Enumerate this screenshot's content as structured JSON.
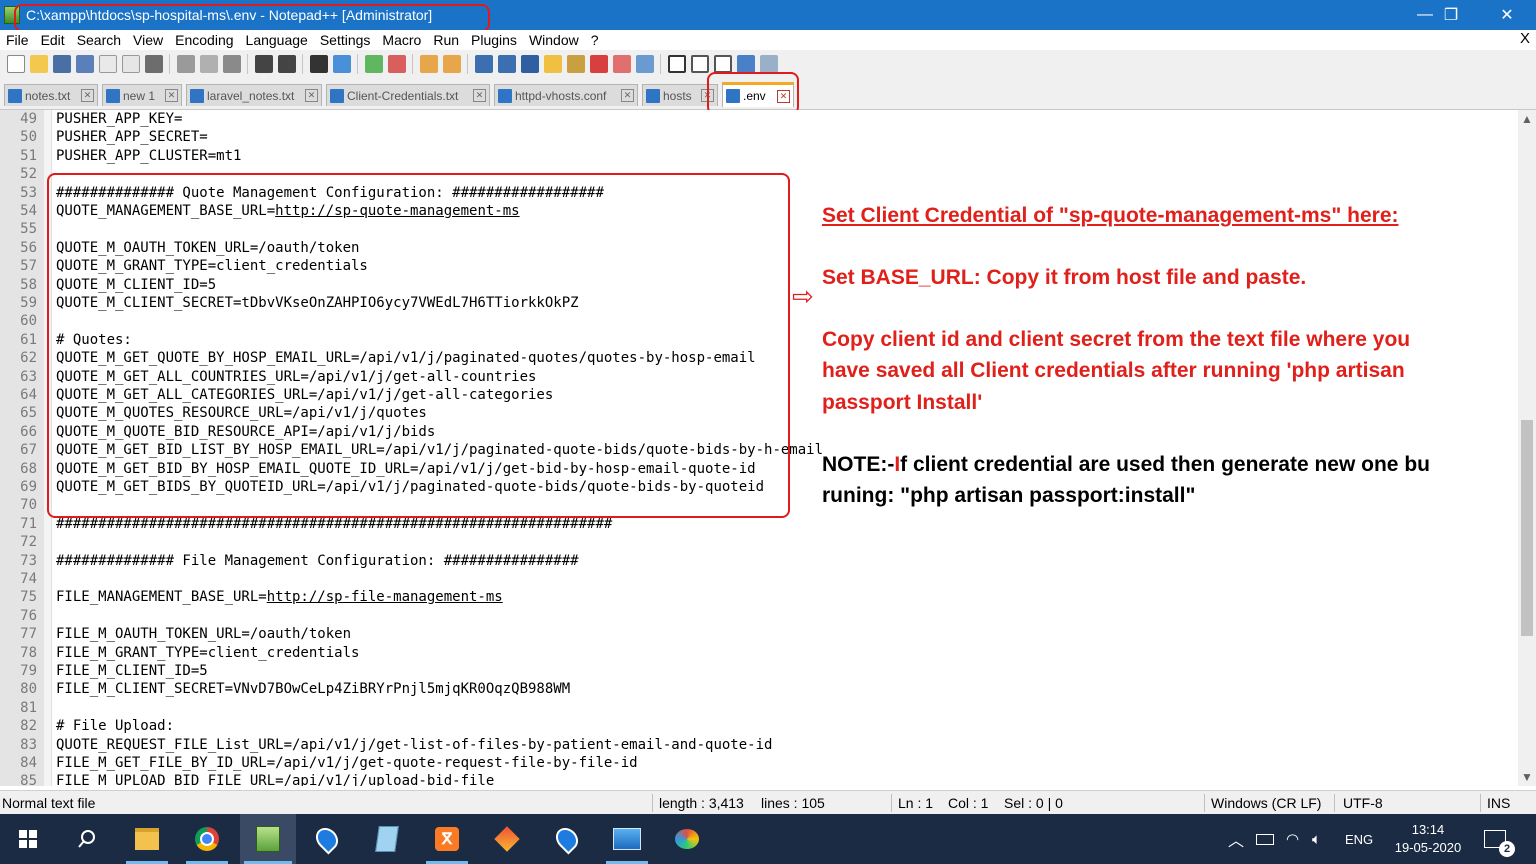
{
  "window": {
    "title": "C:\\xampp\\htdocs\\sp-hospital-ms\\.env - Notepad++ [Administrator]",
    "minimize": "—",
    "maximize": "❐",
    "close": "✕"
  },
  "menu": {
    "items": [
      "File",
      "Edit",
      "Search",
      "View",
      "Encoding",
      "Language",
      "Settings",
      "Macro",
      "Run",
      "Plugins",
      "Window",
      "?"
    ],
    "close_doc": "X"
  },
  "tabs": [
    {
      "label": "notes.txt",
      "active": false
    },
    {
      "label": "new 1",
      "active": false
    },
    {
      "label": "laravel_notes.txt",
      "active": false
    },
    {
      "label": "Client-Credentials.txt",
      "active": false
    },
    {
      "label": "httpd-vhosts.conf",
      "active": false
    },
    {
      "label": "hosts",
      "active": false
    },
    {
      "label": ".env",
      "active": true
    }
  ],
  "editor": {
    "lines": [
      {
        "n": "49",
        "text": "PUSHER_APP_KEY="
      },
      {
        "n": "50",
        "text": "PUSHER_APP_SECRET="
      },
      {
        "n": "51",
        "text": "PUSHER_APP_CLUSTER=mt1"
      },
      {
        "n": "52",
        "text": ""
      },
      {
        "n": "53",
        "text": "############## Quote Management Configuration: ##################"
      },
      {
        "n": "54",
        "text": "QUOTE_MANAGEMENT_BASE_URL=",
        "link": "http://sp-quote-management-ms"
      },
      {
        "n": "55",
        "text": ""
      },
      {
        "n": "56",
        "text": "QUOTE_M_OAUTH_TOKEN_URL=/oauth/token"
      },
      {
        "n": "57",
        "text": "QUOTE_M_GRANT_TYPE=client_credentials"
      },
      {
        "n": "58",
        "text": "QUOTE_M_CLIENT_ID=5"
      },
      {
        "n": "59",
        "text": "QUOTE_M_CLIENT_SECRET=tDbvVKseOnZAHPIO6ycy7VWEdL7H6TTiorkkOkPZ"
      },
      {
        "n": "60",
        "text": ""
      },
      {
        "n": "61",
        "text": "# Quotes:"
      },
      {
        "n": "62",
        "text": "QUOTE_M_GET_QUOTE_BY_HOSP_EMAIL_URL=/api/v1/j/paginated-quotes/quotes-by-hosp-email"
      },
      {
        "n": "63",
        "text": "QUOTE_M_GET_ALL_COUNTRIES_URL=/api/v1/j/get-all-countries"
      },
      {
        "n": "64",
        "text": "QUOTE_M_GET_ALL_CATEGORIES_URL=/api/v1/j/get-all-categories"
      },
      {
        "n": "65",
        "text": "QUOTE_M_QUOTES_RESOURCE_URL=/api/v1/j/quotes"
      },
      {
        "n": "66",
        "text": "QUOTE_M_QUOTE_BID_RESOURCE_API=/api/v1/j/bids"
      },
      {
        "n": "67",
        "text": "QUOTE_M_GET_BID_LIST_BY_HOSP_EMAIL_URL=/api/v1/j/paginated-quote-bids/quote-bids-by-h-email"
      },
      {
        "n": "68",
        "text": "QUOTE_M_GET_BID_BY_HOSP_EMAIL_QUOTE_ID_URL=/api/v1/j/get-bid-by-hosp-email-quote-id"
      },
      {
        "n": "69",
        "text": "QUOTE_M_GET_BIDS_BY_QUOTEID_URL=/api/v1/j/paginated-quote-bids/quote-bids-by-quoteid"
      },
      {
        "n": "70",
        "text": ""
      },
      {
        "n": "71",
        "text": "##################################################################"
      },
      {
        "n": "72",
        "text": ""
      },
      {
        "n": "73",
        "text": "############## File Management Configuration: ################"
      },
      {
        "n": "74",
        "text": ""
      },
      {
        "n": "75",
        "text": "FILE_MANAGEMENT_BASE_URL=",
        "link": "http://sp-file-management-ms"
      },
      {
        "n": "76",
        "text": ""
      },
      {
        "n": "77",
        "text": "FILE_M_OAUTH_TOKEN_URL=/oauth/token"
      },
      {
        "n": "78",
        "text": "FILE_M_GRANT_TYPE=client_credentials"
      },
      {
        "n": "79",
        "text": "FILE_M_CLIENT_ID=5"
      },
      {
        "n": "80",
        "text": "FILE_M_CLIENT_SECRET=VNvD7BOwCeLp4ZiBRYrPnjl5mjqKR0OqzQB988WM"
      },
      {
        "n": "81",
        "text": ""
      },
      {
        "n": "82",
        "text": "# File Upload:"
      },
      {
        "n": "83",
        "text": "QUOTE_REQUEST_FILE_List_URL=/api/v1/j/get-list-of-files-by-patient-email-and-quote-id"
      },
      {
        "n": "84",
        "text": "FILE_M_GET_FILE_BY_ID_URL=/api/v1/j/get-quote-request-file-by-file-id"
      },
      {
        "n": "85",
        "text": "FILE_M_UPLOAD_BID_FILE_URL=/api/v1/j/upload-bid-file"
      }
    ]
  },
  "annotations": {
    "arrow": "⇨",
    "heading": "Set Client Credential of \"sp-quote-management-ms\" here:",
    "base_url": "Set BASE_URL: Copy it from host file and paste.",
    "copy_line1": "Copy client id and client secret from the text file where you",
    "copy_line2": "have saved all Client credentials after running 'php artisan",
    "copy_line3": "passport Install'",
    "note_prefix": "NOTE:-",
    "note_first": "I",
    "note_line1_rest": "f client credential are used then generate new one bu",
    "note_line2": "runing: \"php artisan passport:install\""
  },
  "statusbar": {
    "file_type": "Normal text file",
    "length": "length : 3,413",
    "lines": "lines : 105",
    "ln": "Ln : 1",
    "col": "Col : 1",
    "sel": "Sel : 0 | 0",
    "eol": "Windows (CR LF)",
    "encoding": "UTF-8",
    "mode": "INS"
  },
  "taskbar": {
    "apps": [
      "start-icon",
      "search-icon",
      "file-explorer-icon",
      "chrome-icon",
      "notepadpp-icon",
      "maps-icon",
      "notepad-icon",
      "xampp-icon",
      "git-icon",
      "maps-icon-2",
      "photos-icon",
      "paint-icon"
    ],
    "language": "ENG",
    "time": "13:14",
    "date": "19-05-2020",
    "notifications": "2"
  },
  "colors": {
    "titlebar": "#1a73c7",
    "annotation_red": "#e01b1b",
    "taskbar": "#1b2b44"
  }
}
